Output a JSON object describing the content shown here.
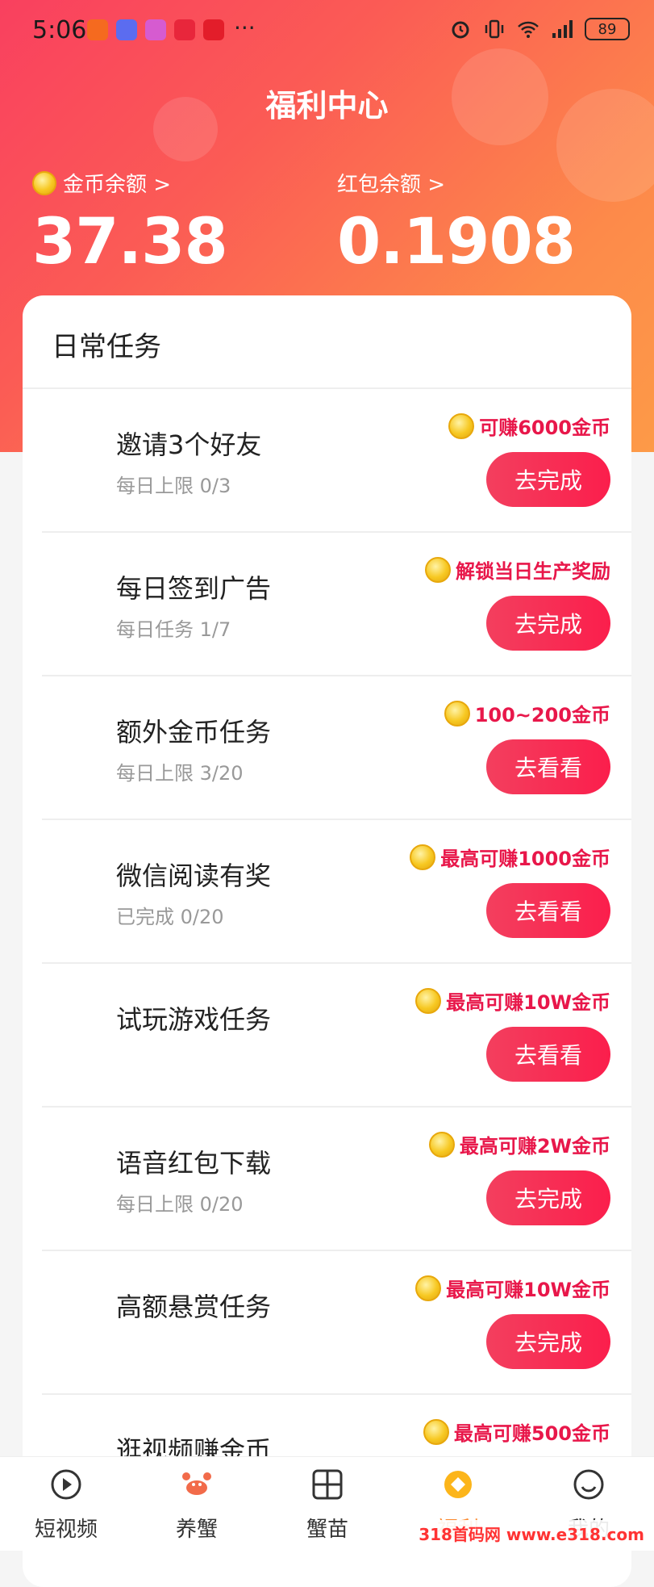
{
  "status": {
    "time": "5:06",
    "more": "···",
    "battery": "89"
  },
  "header": {
    "title": "福利中心",
    "coin_label": "金币余额 >",
    "coin_value": "37.38",
    "redpacket_label": "红包余额 >",
    "redpacket_value": "0.1908"
  },
  "tasks_section": {
    "title": "日常任务",
    "items": [
      {
        "name": "邀请3个好友",
        "sub": "每日上限 0/3",
        "reward": "可赚6000金币",
        "button": "去完成"
      },
      {
        "name": "每日签到广告",
        "sub": "每日任务 1/7",
        "reward": "解锁当日生产奖励",
        "button": "去完成"
      },
      {
        "name": "额外金币任务",
        "sub": "每日上限 3/20",
        "reward": "100~200金币",
        "button": "去看看"
      },
      {
        "name": "微信阅读有奖",
        "sub": "已完成 0/20",
        "reward": "最高可赚1000金币",
        "button": "去看看"
      },
      {
        "name": "试玩游戏任务",
        "sub": "",
        "reward": "最高可赚10W金币",
        "button": "去看看"
      },
      {
        "name": "语音红包下载",
        "sub": "每日上限 0/20",
        "reward": "最高可赚2W金币",
        "button": "去完成"
      },
      {
        "name": "高额悬赏任务",
        "sub": "",
        "reward": "最高可赚10W金币",
        "button": "去完成"
      },
      {
        "name": "逛视频赚金币",
        "sub": "",
        "reward": "最高可赚500金币",
        "button": ""
      }
    ]
  },
  "tabbar": {
    "items": [
      {
        "label": "短视频",
        "icon": "play-icon"
      },
      {
        "label": "养蟹",
        "icon": "crab-icon"
      },
      {
        "label": "蟹苗",
        "icon": "grid-icon"
      },
      {
        "label": "福利",
        "icon": "coin-icon"
      },
      {
        "label": "我的",
        "icon": "smile-icon"
      }
    ],
    "active": "福利"
  },
  "watermark": "318首码网 www.e318.com",
  "colors": {
    "accent": "#f9405f",
    "reward_text": "#e8174a",
    "active_tab": "#fb8a2f"
  }
}
